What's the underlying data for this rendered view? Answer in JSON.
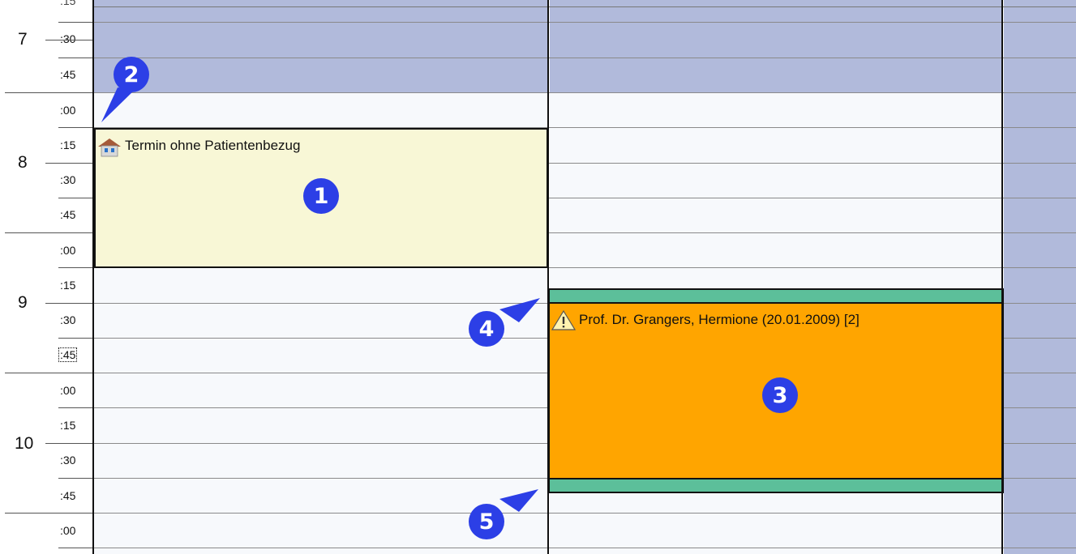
{
  "time_axis": {
    "hours": [
      "7",
      "8",
      "9",
      "10"
    ],
    "minute_labels": [
      ":30",
      ":45",
      ":00",
      ":15",
      ":30",
      ":45",
      ":00",
      ":15",
      ":30",
      ":45",
      ":00",
      ":15",
      ":30",
      ":45",
      ":00"
    ],
    "partial_top_label": ":15"
  },
  "appointments": [
    {
      "title": "Termin ohne Patientenbezug",
      "icon": "house-icon",
      "color": "#f8f7d6"
    },
    {
      "title": "Prof. Dr. Grangers, Hermione (20.01.2009) [2]",
      "icon": "warning-icon",
      "color": "#ffa500",
      "buffer_color": "#5cbf9a"
    }
  ],
  "callouts": [
    "1",
    "2",
    "3",
    "4",
    "5"
  ],
  "colors": {
    "unavailable": "#b1badb",
    "available": "#f7f9fc",
    "badge": "#2c3fe6"
  }
}
